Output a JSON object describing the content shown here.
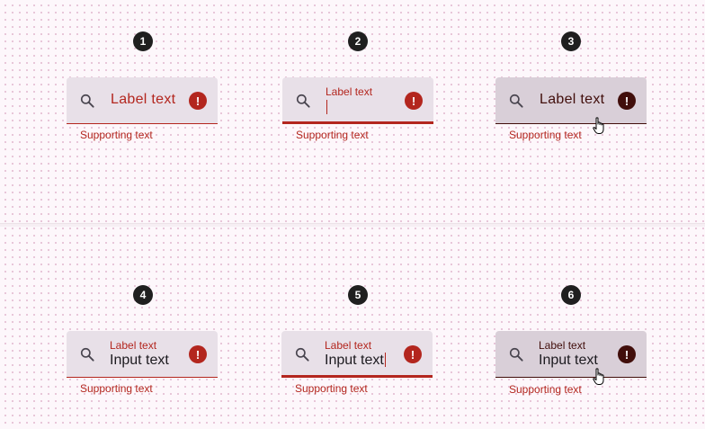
{
  "states": [
    {
      "number": "1",
      "label": "Label text",
      "input": "",
      "supporting": "Supporting text",
      "state": "enabled"
    },
    {
      "number": "2",
      "label": "Label text",
      "input": "",
      "supporting": "Supporting text",
      "state": "focused"
    },
    {
      "number": "3",
      "label": "Label text",
      "input": "",
      "supporting": "Supporting text",
      "state": "hovered"
    },
    {
      "number": "4",
      "label": "Label text",
      "input": "Input text",
      "supporting": "Supporting text",
      "state": "enabled"
    },
    {
      "number": "5",
      "label": "Label text",
      "input": "Input text",
      "supporting": "Supporting text",
      "state": "focused"
    },
    {
      "number": "6",
      "label": "Label text",
      "input": "Input text",
      "supporting": "Supporting text",
      "state": "hovered"
    }
  ],
  "icons": {
    "leading": "search-icon",
    "trailing": "error-icon",
    "trailing_glyph": "!",
    "pointer": "hand-pointer-icon"
  },
  "colors": {
    "error": "#b3261e",
    "on_error_container": "#410e0b",
    "container": "#e8e0e8",
    "container_hover": "#d9cfd8",
    "badge": "#1f1f1f",
    "on_surface": "#1d1b20"
  }
}
